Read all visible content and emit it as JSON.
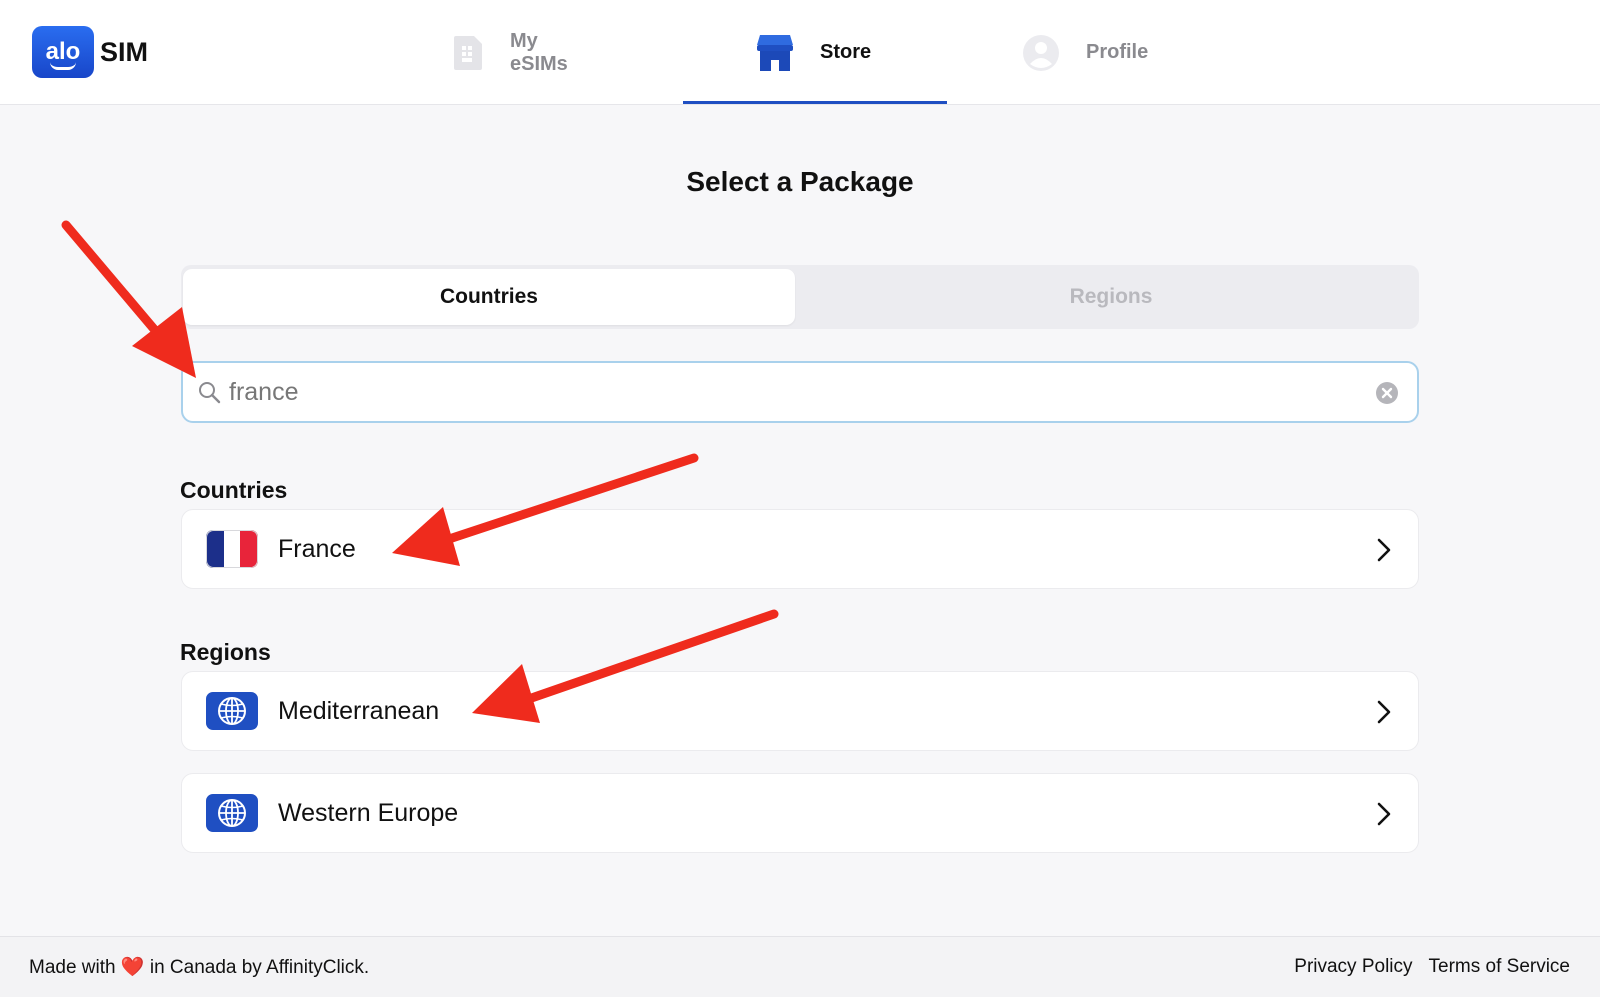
{
  "brand": {
    "logo_badge": "alo",
    "logo_text": "SIM",
    "color": "#1f4fc2"
  },
  "nav": {
    "items": [
      {
        "label": "My eSIMs",
        "icon": "sim-card-icon",
        "active": false
      },
      {
        "label": "Store",
        "icon": "store-icon",
        "active": true
      },
      {
        "label": "Profile",
        "icon": "profile-icon",
        "active": false
      }
    ]
  },
  "main": {
    "title": "Select a Package",
    "tabs": [
      {
        "label": "Countries",
        "active": true
      },
      {
        "label": "Regions",
        "active": false
      }
    ],
    "search": {
      "value": "france",
      "icon": "search-icon",
      "clear_icon": "clear-icon"
    },
    "sections": [
      {
        "label": "Countries",
        "items": [
          {
            "label": "France",
            "icon": "france-flag-icon"
          }
        ]
      },
      {
        "label": "Regions",
        "items": [
          {
            "label": "Mediterranean",
            "icon": "globe-icon"
          },
          {
            "label": "Western Europe",
            "icon": "globe-icon"
          }
        ]
      }
    ]
  },
  "footer": {
    "made_prefix": "Made with",
    "heart": "❤️",
    "made_suffix": "in Canada by AffinityClick.",
    "links": [
      "Privacy Policy",
      "Terms of Service"
    ]
  },
  "annotations": {
    "arrow_color": "#ef2b1d"
  }
}
